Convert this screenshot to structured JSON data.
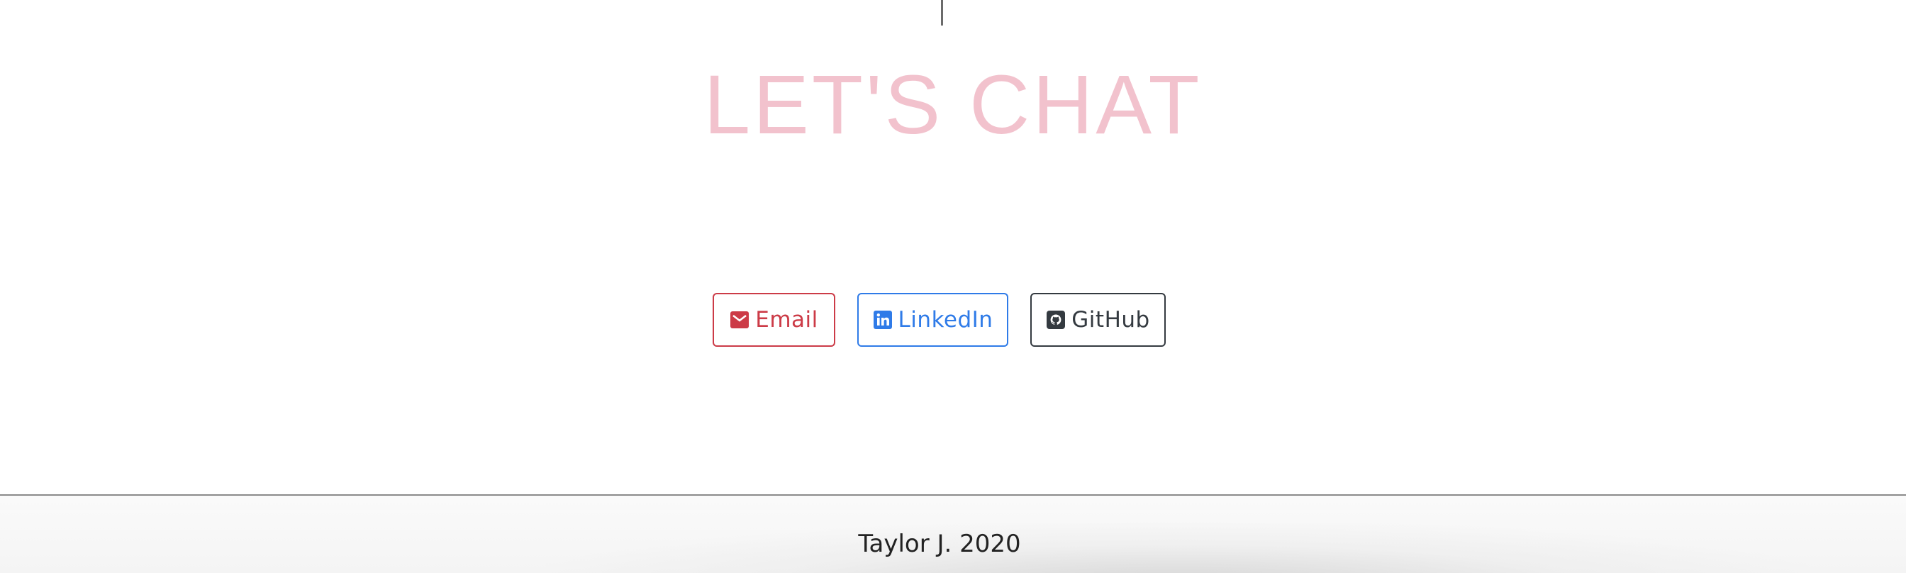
{
  "contact": {
    "title": "LET'S CHAT",
    "buttons": [
      {
        "label": "Email",
        "icon": "envelope-icon",
        "color": "#cc3b47"
      },
      {
        "label": "LinkedIn",
        "icon": "linkedin-icon",
        "color": "#2f7be8"
      },
      {
        "label": "GitHub",
        "icon": "github-icon",
        "color": "#343a40"
      }
    ]
  },
  "footer": {
    "text": "Taylor J. 2020"
  },
  "colors": {
    "title": "#f2c2cd",
    "divider": "#8a8a8a"
  }
}
